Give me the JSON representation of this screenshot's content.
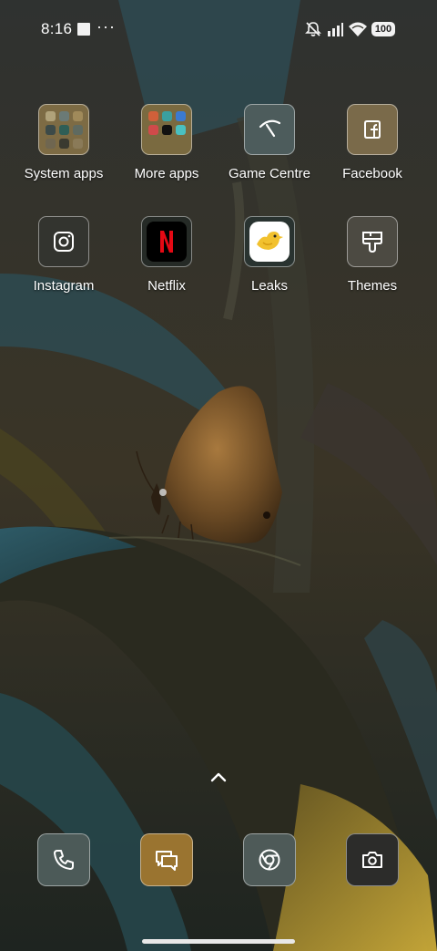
{
  "status_bar": {
    "time": "8:16",
    "more_indicator": "···",
    "battery": "100",
    "icons": [
      "mute-icon",
      "signal-icon",
      "wifi-icon",
      "battery-icon"
    ]
  },
  "apps": [
    {
      "label": "System apps",
      "icon": "folder-icon",
      "tile_color": "#7d6b44"
    },
    {
      "label": "More apps",
      "icon": "folder-icon",
      "tile_color": "#7a6a40"
    },
    {
      "label": "Game Centre",
      "icon": "game-centre-icon",
      "tile_color": "#4d5c5c"
    },
    {
      "label": "Facebook",
      "icon": "facebook-icon",
      "tile_color": "#7a6a4a"
    },
    {
      "label": "Instagram",
      "icon": "instagram-icon",
      "tile_color": "#33342f"
    },
    {
      "label": "Netflix",
      "icon": "netflix-icon",
      "tile_color": "#252a26"
    },
    {
      "label": "Leaks",
      "icon": "leaks-bird-icon",
      "tile_color": "#293330"
    },
    {
      "label": "Themes",
      "icon": "themes-brush-icon",
      "tile_color": "#4c4a42"
    }
  ],
  "dock": [
    {
      "name": "phone",
      "icon": "phone-icon",
      "tile_color": "#4c5a58"
    },
    {
      "name": "messages",
      "icon": "messages-icon",
      "tile_color": "#9a7430"
    },
    {
      "name": "chrome",
      "icon": "chrome-icon",
      "tile_color": "#4e5a58"
    },
    {
      "name": "camera",
      "icon": "camera-icon",
      "tile_color": "#2c2c2a"
    }
  ],
  "drawer_hint": "chevron-up-icon"
}
